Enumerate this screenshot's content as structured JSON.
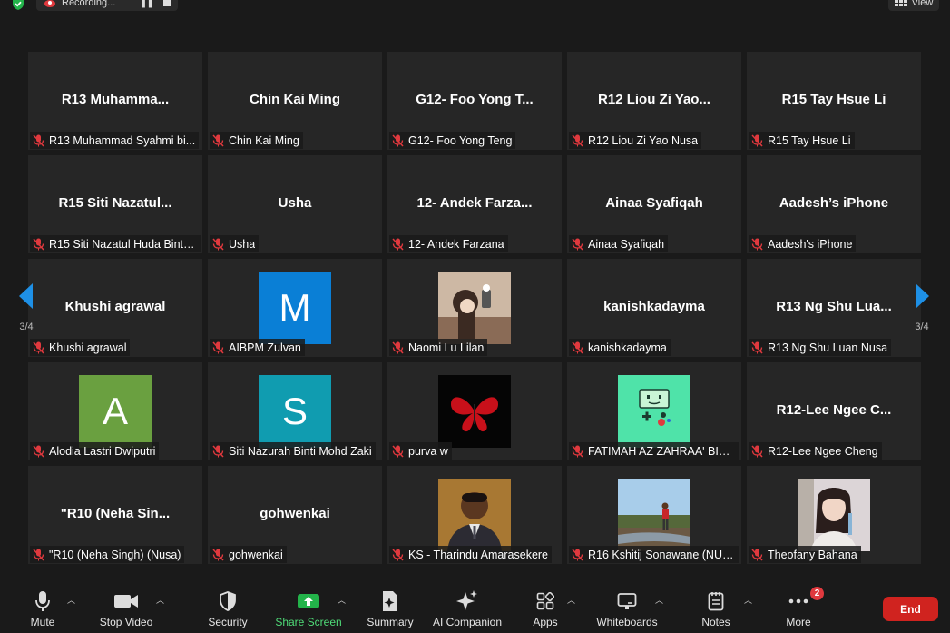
{
  "topbar": {
    "recording_label": "Recording...",
    "view_label": "View"
  },
  "pagination": {
    "left_page": "3/4",
    "right_page": "3/4"
  },
  "tiles": [
    {
      "display": "R13  Muhamma...",
      "label": "R13 Muhammad Syahmi bi..."
    },
    {
      "display": "Chin Kai Ming",
      "label": "Chin Kai Ming"
    },
    {
      "display": "G12- Foo Yong T...",
      "label": "G12- Foo Yong Teng"
    },
    {
      "display": "R12  Liou Zi Yao...",
      "label": "R12 Liou Zi Yao Nusa"
    },
    {
      "display": "R15  Tay Hsue Li",
      "label": "R15 Tay Hsue Li"
    },
    {
      "display": "R15  Siti Nazatul...",
      "label": "R15 Siti Nazatul Huda Binti ..."
    },
    {
      "display": "Usha",
      "label": "Usha"
    },
    {
      "display": "12- Andek Farza...",
      "label": "12- Andek Farzana"
    },
    {
      "display": "Ainaa Syafiqah",
      "label": "Ainaa Syafiqah"
    },
    {
      "display": "Aadesh’s iPhone",
      "label": "Aadesh's iPhone"
    },
    {
      "display": "Khushi agrawal",
      "label": "Khushi agrawal"
    },
    {
      "avatar_letter": "M",
      "avatar_color": "#0a7fd6",
      "label": "AIBPM Zulvan"
    },
    {
      "photo": "naomi",
      "label": "Naomi Lu Lilan"
    },
    {
      "display": "kanishkadayma",
      "label": "kanishkadayma"
    },
    {
      "display": "R13  Ng Shu Lua...",
      "label": "R13 Ng Shu Luan  Nusa"
    },
    {
      "avatar_letter": "A",
      "avatar_color": "#6aa040",
      "label": "Alodia Lastri Dwiputri"
    },
    {
      "avatar_letter": "S",
      "avatar_color": "#109cb0",
      "label": "Siti Nazurah Binti Mohd Zaki"
    },
    {
      "photo": "butterfly",
      "label": "purva w"
    },
    {
      "photo": "bmo",
      "label": "FATIMAH AZ ZAHRAA' BINT..."
    },
    {
      "display": "R12-Lee Ngee C...",
      "label": "R12-Lee Ngee Cheng"
    },
    {
      "display": "\"R10  (Neha Sin...",
      "label": "\"R10 (Neha Singh) (Nusa)"
    },
    {
      "display": "gohwenkai",
      "label": "gohwenkai"
    },
    {
      "photo": "tharindu",
      "label": "KS - Tharindu Amarasekere"
    },
    {
      "photo": "kshitij",
      "label": "R16 Kshitij Sonawane (NUS..."
    },
    {
      "photo": "theofany",
      "label": "Theofany Bahana"
    }
  ],
  "toolbar": {
    "mute": "Mute",
    "stop_video": "Stop Video",
    "security": "Security",
    "share_screen": "Share Screen",
    "summary": "Summary",
    "ai_companion": "AI Companion",
    "apps": "Apps",
    "whiteboards": "Whiteboards",
    "notes": "Notes",
    "more": "More",
    "more_badge": "2",
    "end": "End"
  },
  "colors": {
    "share_green": "#4fdc78",
    "end_red": "#d0231f",
    "mic_off_red": "#e0393e"
  }
}
